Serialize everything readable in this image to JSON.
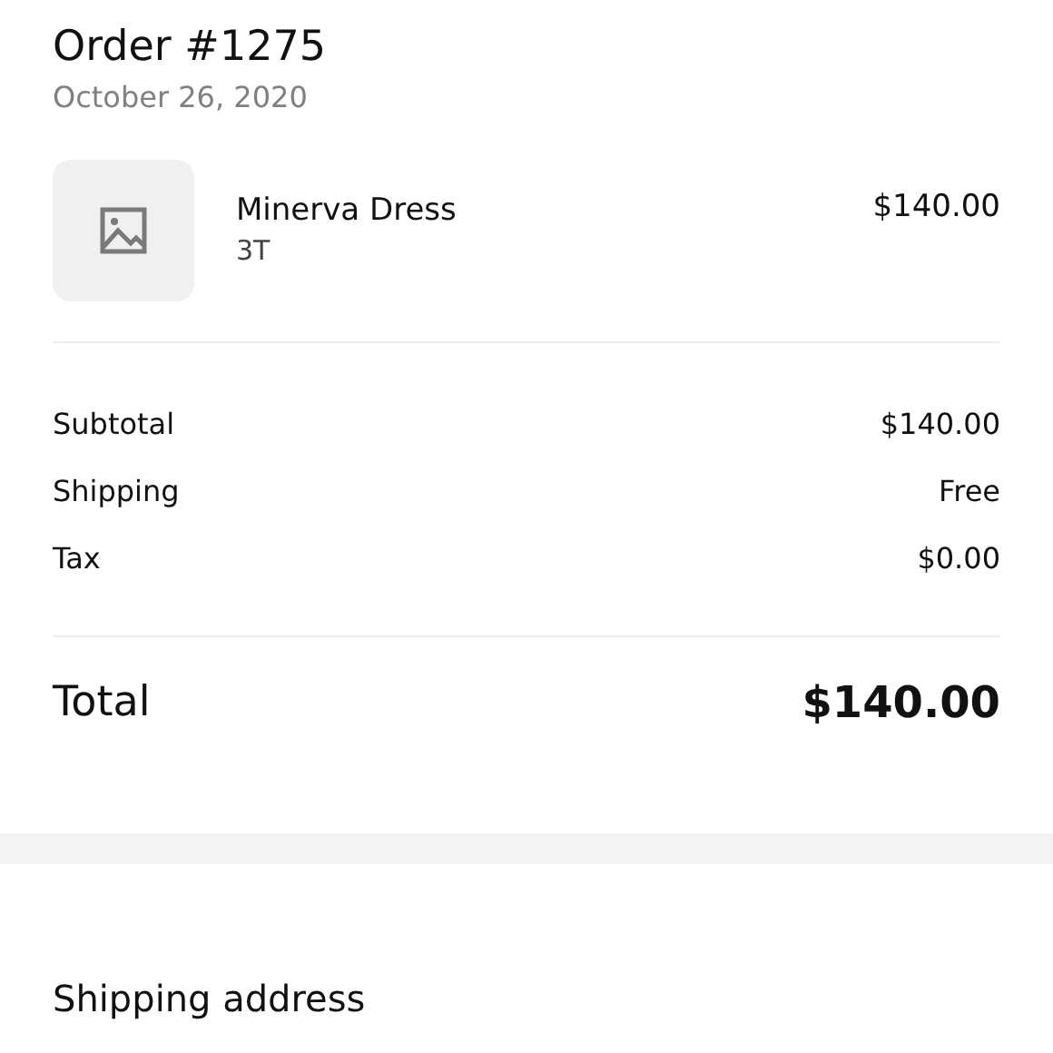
{
  "order": {
    "title": "Order #1275",
    "date": "October 26, 2020"
  },
  "items": [
    {
      "name": "Minerva Dress",
      "variant": "3T",
      "price": "$140.00"
    }
  ],
  "summary": [
    {
      "label": "Subtotal",
      "value": "$140.00"
    },
    {
      "label": "Shipping",
      "value": "Free"
    },
    {
      "label": "Tax",
      "value": "$0.00"
    }
  ],
  "total": {
    "label": "Total",
    "value": "$140.00"
  },
  "shipping_section": {
    "heading": "Shipping address"
  }
}
